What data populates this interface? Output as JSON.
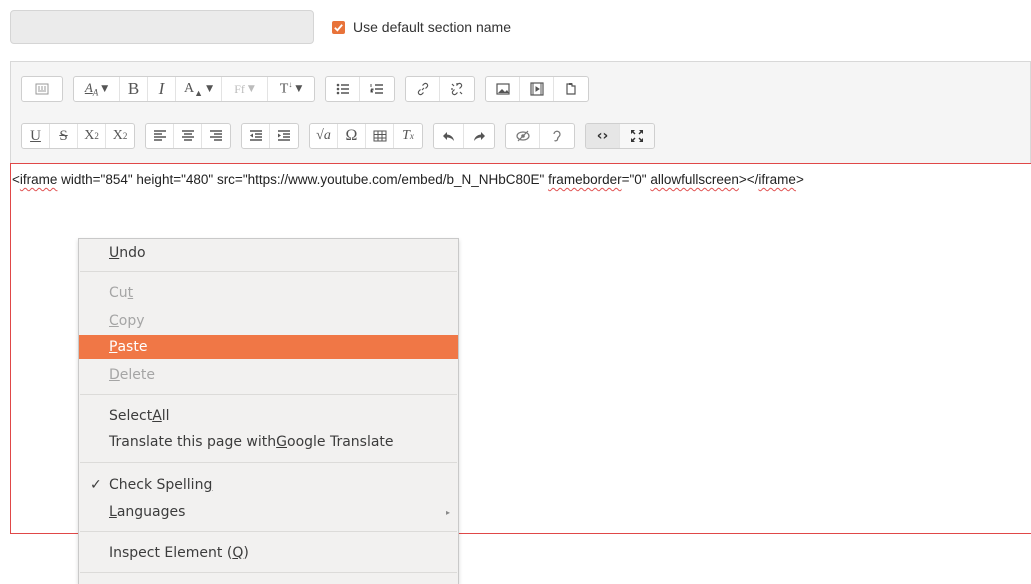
{
  "section_name": {
    "value": "",
    "checkbox_label": "Use default section name",
    "checked": true
  },
  "toolbar": {
    "row1": [
      {
        "group": "format",
        "buttons": [
          {
            "name": "show-more-icon",
            "label": ""
          }
        ]
      },
      {
        "group": "style",
        "buttons": [
          {
            "name": "font-size-icon",
            "label": "Aₐ",
            "caret": "▼"
          },
          {
            "name": "bold",
            "label": "B"
          },
          {
            "name": "italic",
            "label": "I"
          },
          {
            "name": "font-color-icon",
            "label": "A",
            "caret": "▼"
          },
          {
            "name": "font-family-icon",
            "label": "Ff",
            "caret": "▼",
            "dim": true
          },
          {
            "name": "text-style-icon",
            "label": "T",
            "caret": "▼"
          }
        ]
      },
      {
        "group": "lists",
        "buttons": [
          {
            "name": "bullet-list-icon"
          },
          {
            "name": "numbered-list-icon"
          }
        ]
      },
      {
        "group": "links",
        "buttons": [
          {
            "name": "link-icon"
          },
          {
            "name": "unlink-icon"
          }
        ]
      },
      {
        "group": "media",
        "buttons": [
          {
            "name": "image-icon"
          },
          {
            "name": "video-icon"
          },
          {
            "name": "file-icon"
          }
        ]
      }
    ],
    "row2": [
      {
        "group": "text",
        "buttons": [
          {
            "name": "underline",
            "label": "U"
          },
          {
            "name": "strikethrough",
            "label": "S"
          },
          {
            "name": "subscript",
            "label": "X₂"
          },
          {
            "name": "superscript",
            "label": "X²"
          }
        ]
      },
      {
        "group": "align",
        "buttons": [
          {
            "name": "align-left-icon"
          },
          {
            "name": "align-center-icon"
          },
          {
            "name": "align-right-icon"
          }
        ]
      },
      {
        "group": "indent",
        "buttons": [
          {
            "name": "outdent-icon"
          },
          {
            "name": "indent-icon"
          }
        ]
      },
      {
        "group": "insert",
        "buttons": [
          {
            "name": "equation-icon",
            "label": "√a"
          },
          {
            "name": "special-char",
            "label": "Ω"
          },
          {
            "name": "table-icon"
          },
          {
            "name": "clear-format-icon",
            "label": "Tₓ"
          }
        ]
      },
      {
        "group": "history",
        "buttons": [
          {
            "name": "undo-icon"
          },
          {
            "name": "redo-icon"
          }
        ]
      },
      {
        "group": "access",
        "buttons": [
          {
            "name": "accessibility-icon"
          },
          {
            "name": "screenreader-icon"
          }
        ]
      },
      {
        "group": "view",
        "buttons": [
          {
            "name": "html-icon",
            "label": "<>"
          },
          {
            "name": "fullscreen-icon"
          }
        ]
      }
    ]
  },
  "editor": {
    "before1": "<",
    "w1": "iframe",
    "mid1": " width=\"854\" height=\"480\" src=\"https://www.youtube.com/embed/b_N_NHbC80E\" ",
    "w2": "frameborder",
    "mid2": "=\"0\" ",
    "w3": "allowfullscreen",
    "mid3": "></",
    "w4": "iframe",
    "end": ">"
  },
  "context_menu": {
    "undo": {
      "pre": "",
      "key": "U",
      "post": "ndo"
    },
    "cut": {
      "pre": "Cu",
      "key": "t",
      "post": ""
    },
    "copy": {
      "pre": "",
      "key": "C",
      "post": "opy"
    },
    "paste": {
      "pre": "",
      "key": "P",
      "post": "aste"
    },
    "delete": {
      "pre": "",
      "key": "D",
      "post": "elete"
    },
    "select_all": {
      "pre": "Select ",
      "key": "A",
      "post": "ll"
    },
    "translate": {
      "pre": "Translate this page with ",
      "key": "G",
      "post": "oogle Translate"
    },
    "check_spelling": {
      "pre": "Check Spellin",
      "key": "g",
      "post": "",
      "check": "✓"
    },
    "languages": {
      "pre": "",
      "key": "L",
      "post": "anguages",
      "arrow": "▸"
    },
    "inspect": {
      "pre": "Inspect Element (",
      "key": "Q",
      "post": ")"
    }
  }
}
